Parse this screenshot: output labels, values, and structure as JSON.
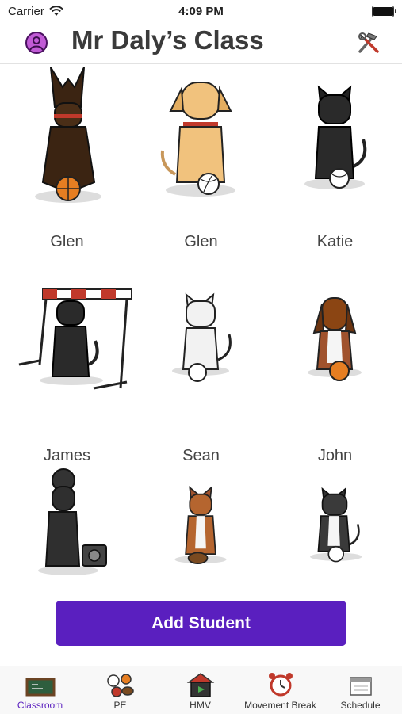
{
  "status_bar": {
    "carrier": "Carrier",
    "time": "4:09 PM",
    "battery_level": 0.95
  },
  "header": {
    "title": "Mr Daly’s Class"
  },
  "students": [
    {
      "name": "Glen",
      "animal": "doberman-dog",
      "ball": "basketball"
    },
    {
      "name": "Glen",
      "animal": "labrador-dog",
      "ball": "volleyball"
    },
    {
      "name": "Katie",
      "animal": "black-cat",
      "ball": "volleyball"
    },
    {
      "name": "James",
      "animal": "black-cat-hurdle",
      "ball": "hurdle"
    },
    {
      "name": "Sean",
      "animal": "white-cat",
      "ball": "volleyball"
    },
    {
      "name": "John",
      "animal": "basset-dog",
      "ball": "basketball"
    },
    {
      "name": "",
      "animal": "black-poodle",
      "ball": "stereo"
    },
    {
      "name": "",
      "animal": "basenji-dog",
      "ball": "football"
    },
    {
      "name": "",
      "animal": "tuxedo-cat",
      "ball": "volleyball"
    }
  ],
  "add_student": {
    "label": "Add Student"
  },
  "tabs": [
    {
      "label": "Classroom",
      "icon": "chalkboard-icon",
      "active": true
    },
    {
      "label": "PE",
      "icon": "sports-balls-icon",
      "active": false
    },
    {
      "label": "HMV",
      "icon": "house-video-icon",
      "active": false
    },
    {
      "label": "Movement Break",
      "icon": "alarm-clock-icon",
      "active": false
    },
    {
      "label": "Schedule",
      "icon": "calendar-icon",
      "active": false
    }
  ],
  "colors": {
    "accent": "#5a1fbf",
    "avatar": "#c15bd6"
  }
}
